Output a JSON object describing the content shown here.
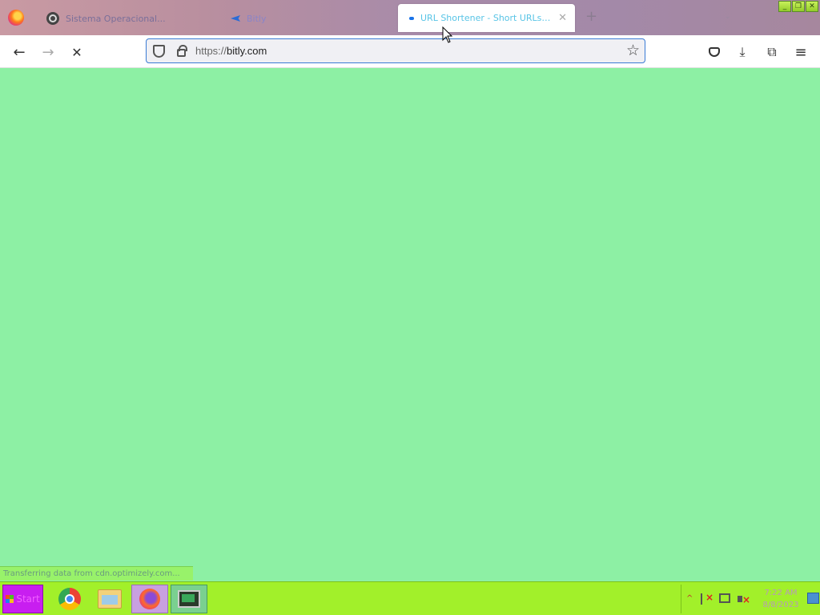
{
  "browser": {
    "tabs": [
      {
        "label": "Sistema Operacional...",
        "icon": "gear-icon",
        "active": false
      },
      {
        "label": "Bitly",
        "icon": "arrow-icon",
        "active": false
      },
      {
        "label": "URL Shortener - Short URLs & C...",
        "icon": "bitly-favicon",
        "active": true
      }
    ],
    "new_tab_glyph": "+",
    "list_tabs_glyph": "⌄",
    "window_controls": {
      "minimize": "_",
      "maximize": "❐",
      "close": "✕"
    }
  },
  "navbar": {
    "back_glyph": "←",
    "forward_glyph": "→",
    "stop_glyph": "✕",
    "url_scheme": "https://",
    "url_host": "bitly.com",
    "star_glyph": "☆",
    "download_glyph": "⤓",
    "extensions_glyph": "⧉",
    "menu_glyph": "≡"
  },
  "status_bar": {
    "text": "Transferring data from cdn.optimizely.com..."
  },
  "taskbar": {
    "start_label": "Start",
    "apps": [
      "chrome",
      "file-explorer",
      "firefox",
      "terminal"
    ],
    "clock": {
      "time": "7:22 AM",
      "date": "8/8/2023"
    },
    "tray_chevron": "^"
  },
  "colors": {
    "content_bg": "#8df0a4",
    "taskbar_bg": "#a2f02a",
    "start_bg": "#c81ef0",
    "url_focus": "#3a7bd5"
  }
}
